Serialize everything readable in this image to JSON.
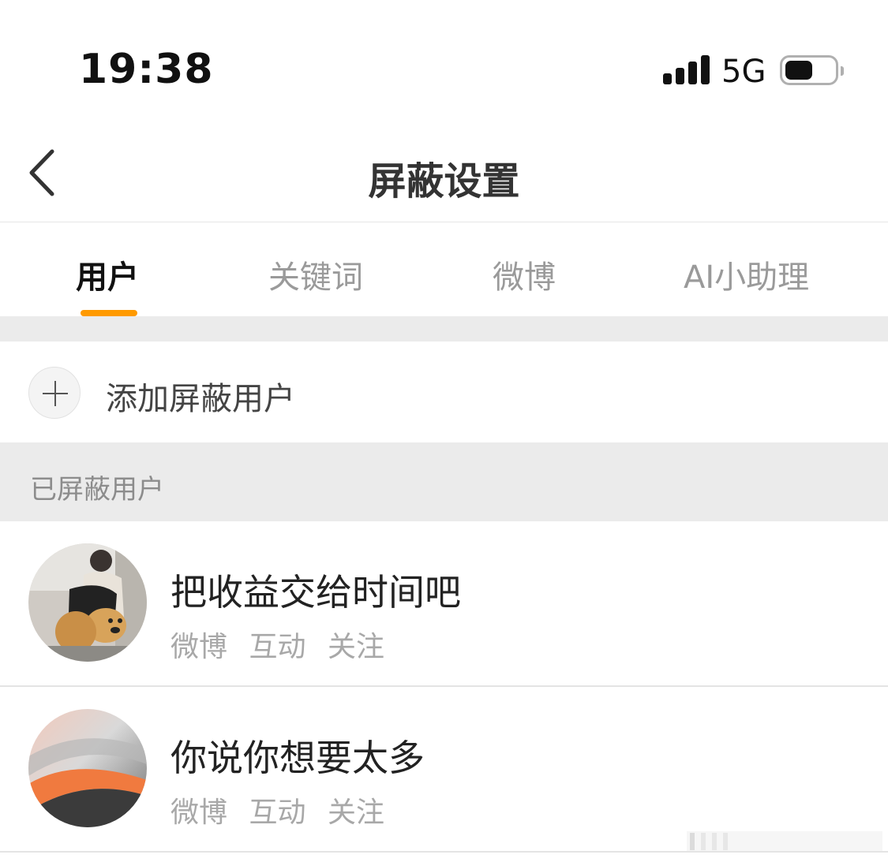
{
  "status_bar": {
    "time": "19:38",
    "network": "5G",
    "signal_icon": "cellular-signal-icon",
    "battery_icon": "battery-icon",
    "battery_level": 0.55
  },
  "nav": {
    "back_icon": "chevron-left-icon",
    "title": "屏蔽设置"
  },
  "tabs": [
    {
      "label": "用户",
      "active": true
    },
    {
      "label": "关键词",
      "active": false
    },
    {
      "label": "微博",
      "active": false
    },
    {
      "label": "AI小助理",
      "active": false
    }
  ],
  "add_row": {
    "icon": "plus-icon",
    "label": "添加屏蔽用户"
  },
  "section": {
    "label": "已屏蔽用户"
  },
  "blocked_users": [
    {
      "name": "把收益交给时间吧",
      "tags": [
        "微博",
        "互动",
        "关注"
      ]
    },
    {
      "name": "你说你想要太多",
      "tags": [
        "微博",
        "互动",
        "关注"
      ]
    }
  ],
  "colors": {
    "accent": "#ff9a00",
    "section_bg": "#ebebeb",
    "inactive_tab": "#9a9a9a"
  }
}
